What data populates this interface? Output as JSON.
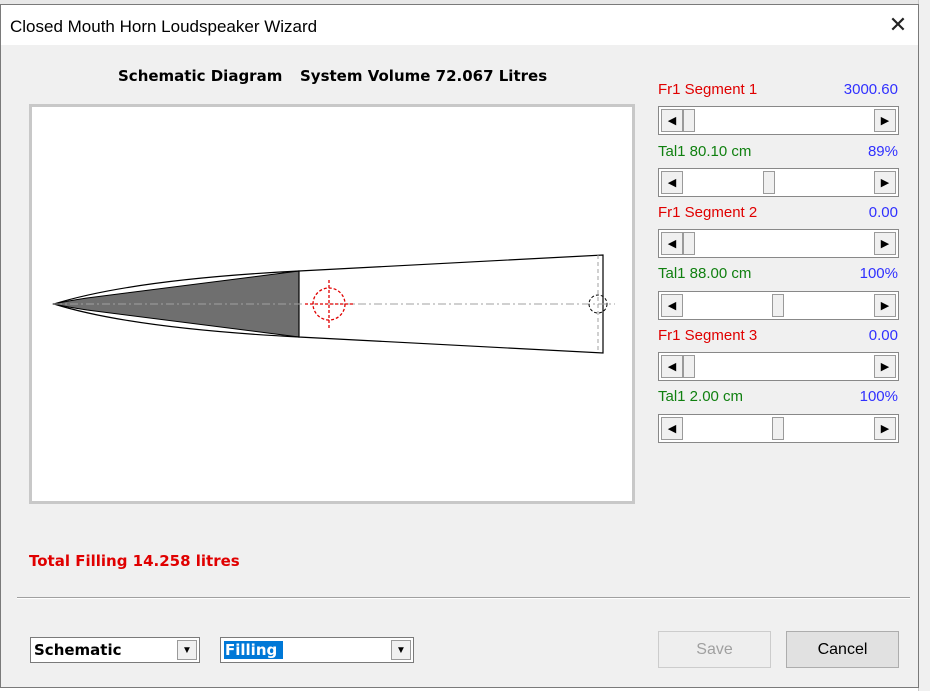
{
  "window": {
    "title": "Closed Mouth Horn Loudspeaker Wizard",
    "close_glyph": "✕"
  },
  "heading": {
    "left": "Schematic Diagram",
    "right": "System Volume 72.067 Litres"
  },
  "segments": [
    {
      "label": "Fr1  Segment 1",
      "value": "3000.60",
      "slider_fraction": 0.0
    },
    {
      "label": "Tal1  80.10 cm",
      "value": "89%",
      "slider_fraction": 0.4
    },
    {
      "label": "Fr1  Segment 2",
      "value": "0.00",
      "slider_fraction": 0.0
    },
    {
      "label": "Tal1  88.00 cm",
      "value": "100%",
      "slider_fraction": 0.44
    },
    {
      "label": "Fr1  Segment 3",
      "value": "0.00",
      "slider_fraction": 0.0
    },
    {
      "label": "Tal1  2.00 cm",
      "value": "100%",
      "slider_fraction": 0.44
    }
  ],
  "total_filling": "Total Filling  14.258 litres",
  "view_select": {
    "value": "Schematic"
  },
  "mode_select": {
    "value": "Filling"
  },
  "buttons": {
    "save": "Save",
    "cancel": "Cancel"
  },
  "icons": {
    "scroll_left": "◀",
    "scroll_right": "▶",
    "dropdown": "▼"
  },
  "colors": {
    "label_red": "#e00000",
    "label_green": "#108010",
    "value_blue": "#3030ff",
    "filling_gray": "#6f6f6f"
  }
}
